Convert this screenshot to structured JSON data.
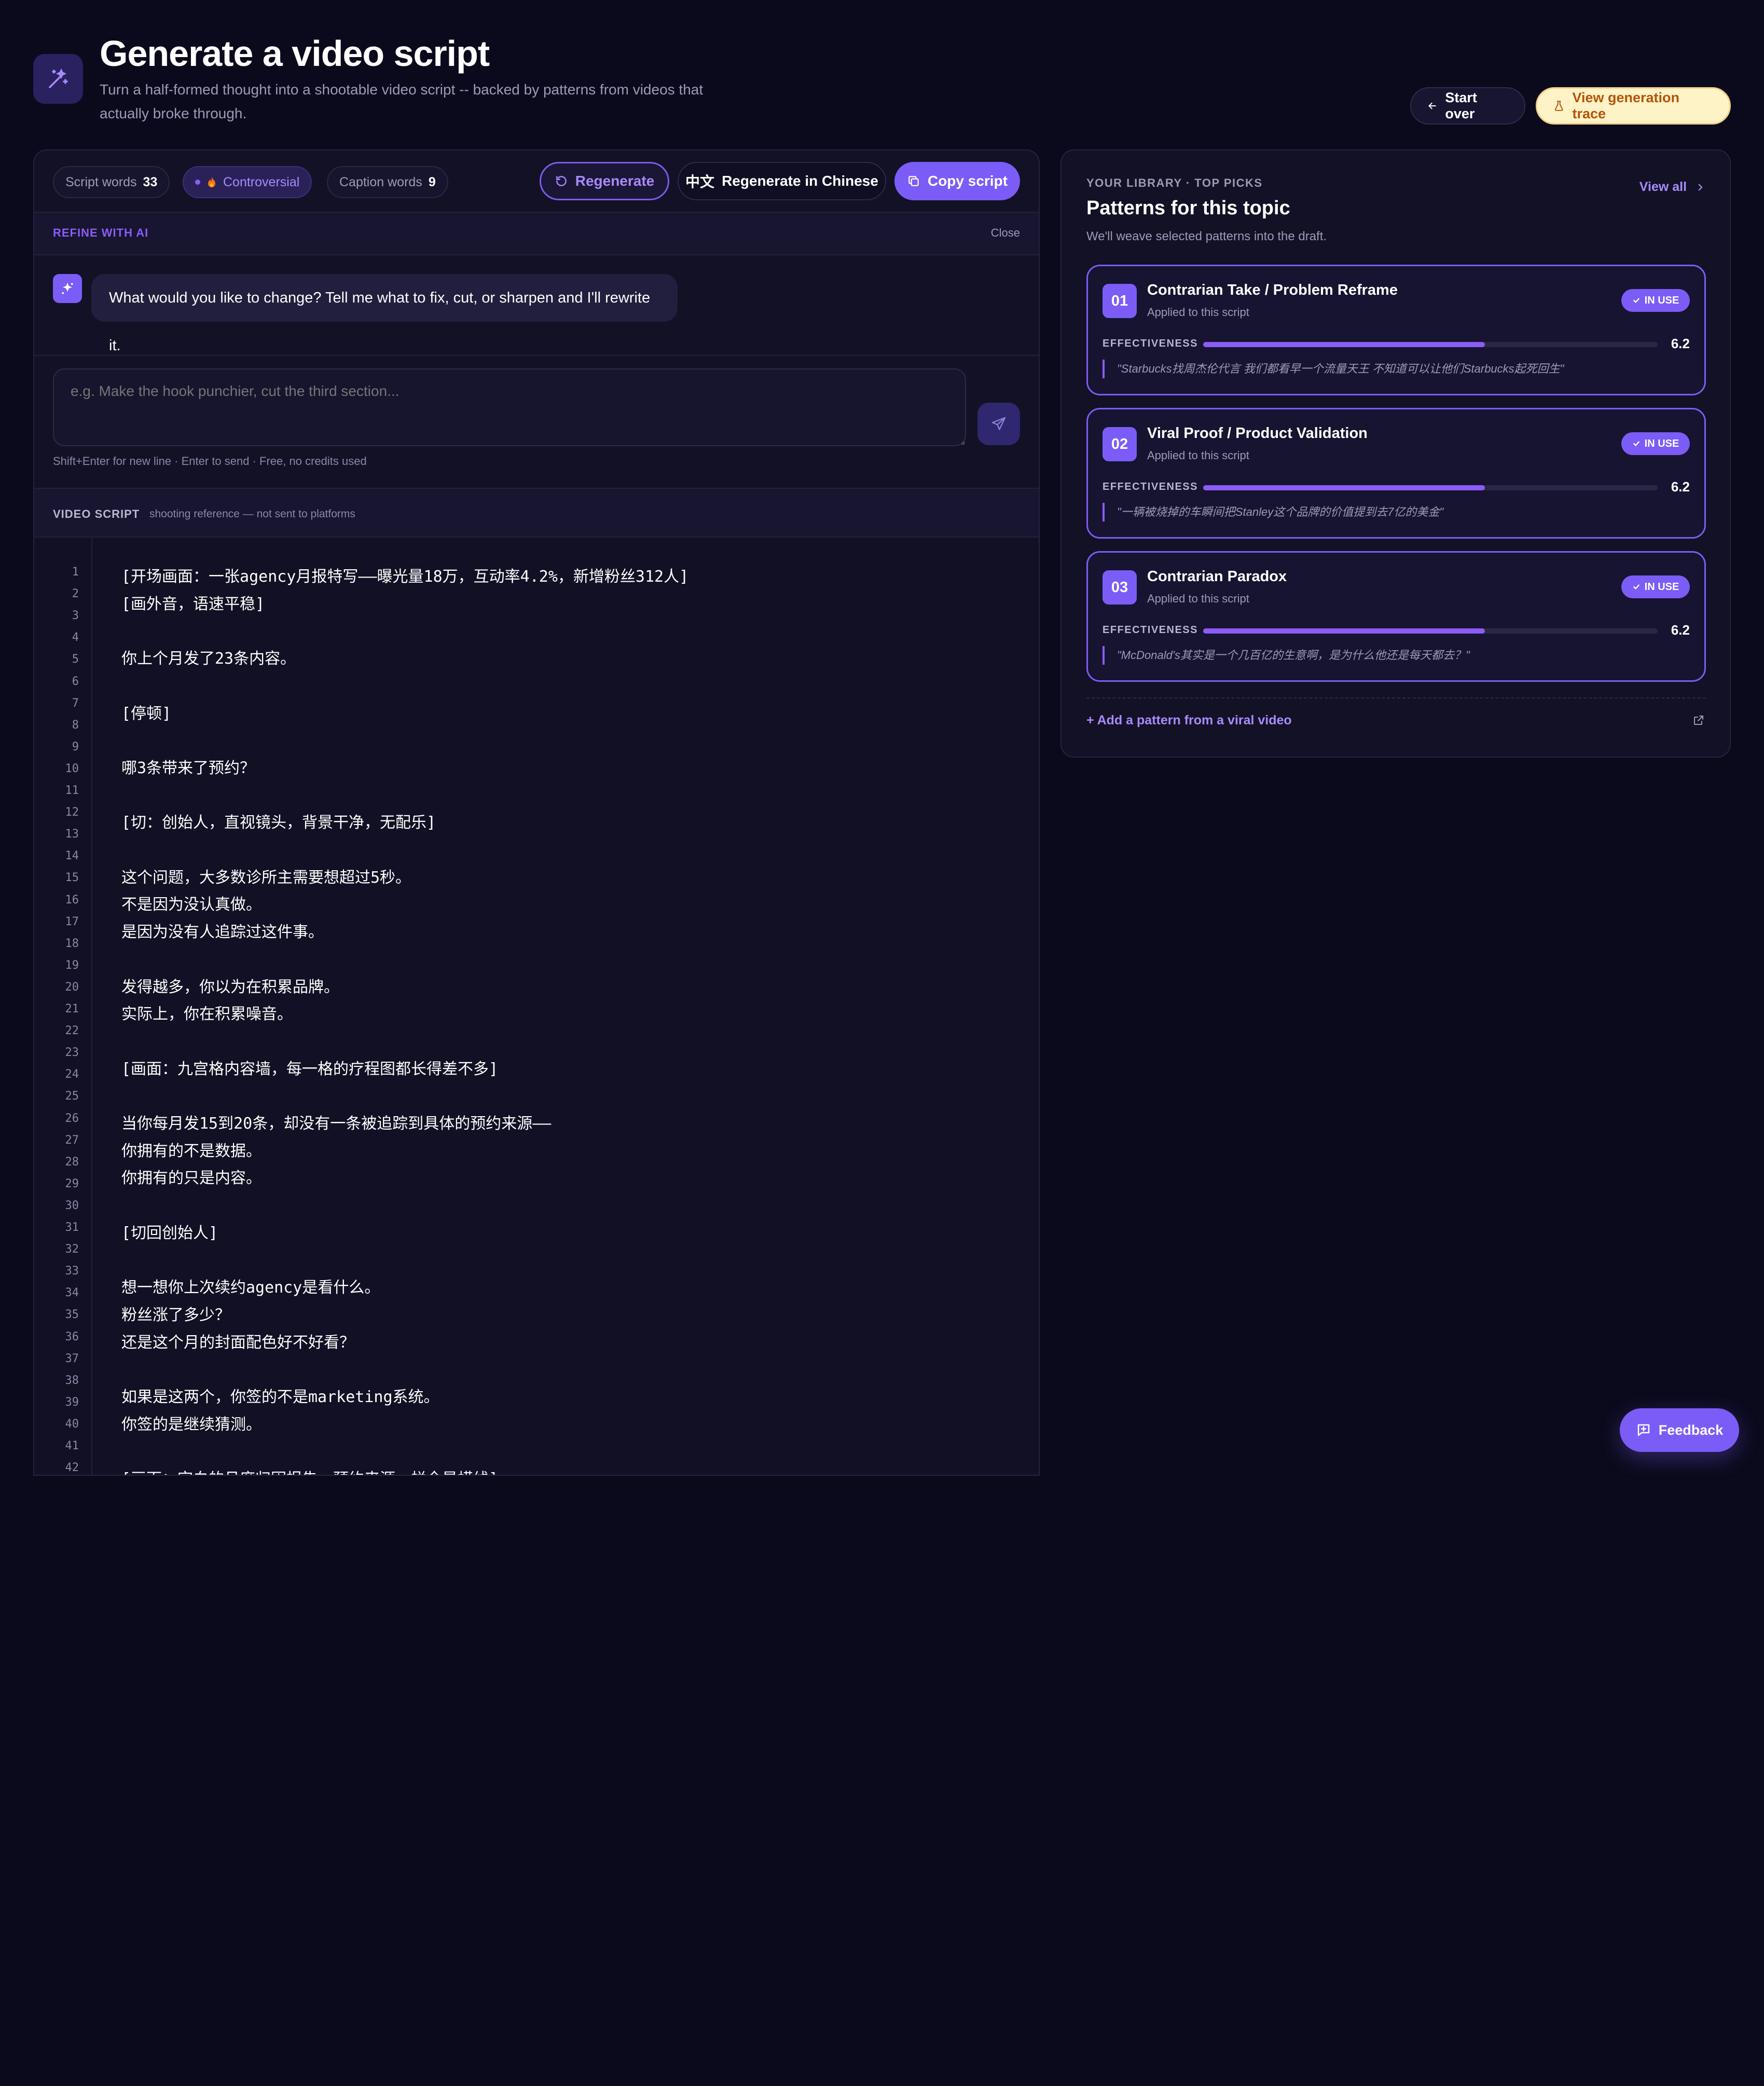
{
  "header": {
    "title": "Generate a video script",
    "subtitle": "Turn a half-formed thought into a shootable video script -- backed by patterns from videos that actually broke through.",
    "start_over": "Start over",
    "view_trace": "View generation trace"
  },
  "toolbar": {
    "script_words_label": "Script words",
    "script_words": "33",
    "tone_label": "Controversial",
    "caption_words_label": "Caption words",
    "caption_words": "9",
    "regenerate": "Regenerate",
    "regen_chinese_prefix": "中文",
    "regen_chinese": "Regenerate in Chinese",
    "copy_script": "Copy script"
  },
  "refine": {
    "label": "REFINE WITH AI",
    "close": "Close",
    "ai_message": "What would you like to change? Tell me what to fix, cut, or sharpen and I'll rewrite it.",
    "input_placeholder": "e.g. Make the hook punchier, cut the third section...",
    "input_value": "",
    "hint": "Shift+Enter for new line · Enter to send · Free, no credits used"
  },
  "script": {
    "label": "VIDEO SCRIPT",
    "note": "shooting reference — not sent to platforms",
    "line_numbers": [
      "1",
      "2",
      "3",
      "4",
      "5",
      "6",
      "7",
      "8",
      "9",
      "10",
      "11",
      "12",
      "13",
      "14",
      "15",
      "16",
      "17",
      "18",
      "19",
      "20",
      "21",
      "22",
      "23",
      "24",
      "25",
      "26",
      "27",
      "28",
      "29",
      "30",
      "31",
      "32",
      "33",
      "34",
      "35",
      "36",
      "37",
      "38",
      "39",
      "40",
      "41",
      "42"
    ],
    "lines": [
      "[开场画面：一张agency月报特写——曝光量18万，互动率4.2%，新增粉丝312人]",
      "[画外音，语速平稳]",
      "",
      "你上个月发了23条内容。",
      "",
      "[停顿]",
      "",
      "哪3条带来了预约？",
      "",
      "[切：创始人，直视镜头，背景干净，无配乐]",
      "",
      "这个问题，大多数诊所主需要想超过5秒。",
      "不是因为没认真做。",
      "是因为没有人追踪过这件事。",
      "",
      "发得越多，你以为在积累品牌。",
      "实际上，你在积累噪音。",
      "",
      "[画面：九宫格内容墙，每一格的疗程图都长得差不多]",
      "",
      "当你每月发15到20条，却没有一条被追踪到具体的预约来源——",
      "你拥有的不是数据。",
      "你拥有的只是内容。",
      "",
      "[切回创始人]",
      "",
      "想一想你上次续约agency是看什么。",
      "粉丝涨了多少？",
      "还是这个月的封面配色好不好看？",
      "",
      "如果是这两个，你签的不是marketing系统。",
      "你签的是继续猜测。",
      "",
      "[画面：空白的月度归因报告，预约来源一栏全是横线]"
    ]
  },
  "library": {
    "eyebrow": "YOUR LIBRARY · TOP PICKS",
    "title": "Patterns for this topic",
    "subtitle": "We'll weave selected patterns into the draft.",
    "view_all": "View all",
    "patterns": [
      {
        "num": "01",
        "name": "Contrarian Take / Problem Reframe",
        "applied": "Applied to this script",
        "badge": "IN USE",
        "eff_label": "EFFECTIVENESS",
        "score": "6.2",
        "score_fraction": 0.62,
        "quote": "\"Starbucks找周杰伦代言 我们都看早一个流量天王 不知道可以让他们Starbucks起死回生\""
      },
      {
        "num": "02",
        "name": "Viral Proof / Product Validation",
        "applied": "Applied to this script",
        "badge": "IN USE",
        "eff_label": "EFFECTIVENESS",
        "score": "6.2",
        "score_fraction": 0.62,
        "quote": "\"一辆被烧掉的车瞬间把Stanley这个品牌的价值提到去7亿的美金\""
      },
      {
        "num": "03",
        "name": "Contrarian Paradox",
        "applied": "Applied to this script",
        "badge": "IN USE",
        "eff_label": "EFFECTIVENESS",
        "score": "6.2",
        "score_fraction": 0.62,
        "quote": "\"McDonald's其实是一个几百亿的生意啊，是为什么他还是每天都去？\""
      }
    ],
    "add_pattern": "+ Add a pattern from a viral video"
  },
  "feedback": "Feedback",
  "colors": {
    "background": "#0b0a1c",
    "panel": "#121126",
    "accent": "#7c5cf6",
    "accent_light": "#a78bfa",
    "trace_bg": "#fef3c7",
    "trace_text": "#b45309"
  }
}
